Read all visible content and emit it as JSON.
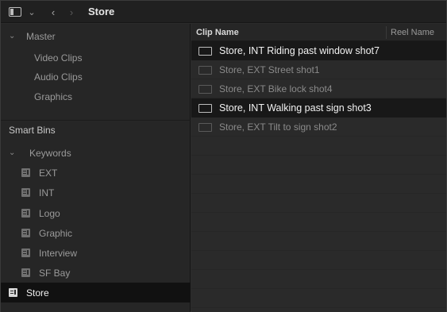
{
  "topbar": {
    "bin_title": "Store",
    "icons": [
      "panel-toggle-icon",
      "chevron-down-icon",
      "back-arrow-icon",
      "forward-arrow-icon"
    ]
  },
  "sidebar": {
    "master": {
      "label": "Master",
      "items": [
        {
          "label": "Video Clips"
        },
        {
          "label": "Audio Clips"
        },
        {
          "label": "Graphics"
        }
      ]
    },
    "smart_bins": {
      "label": "Smart Bins"
    },
    "keywords": {
      "label": "Keywords",
      "items": [
        {
          "label": "EXT"
        },
        {
          "label": "INT"
        },
        {
          "label": "Logo"
        },
        {
          "label": "Graphic"
        },
        {
          "label": "Interview"
        },
        {
          "label": "SF Bay"
        },
        {
          "label": "Store"
        }
      ],
      "active_index": 6
    }
  },
  "main": {
    "columns": {
      "clip_name": "Clip Name",
      "reel_name": "Reel Name"
    },
    "clips": [
      {
        "name": "Store, INT Riding past window shot7",
        "highlighted": true
      },
      {
        "name": "Store, EXT Street shot1",
        "highlighted": false
      },
      {
        "name": "Store, EXT Bike lock shot4",
        "highlighted": false
      },
      {
        "name": "Store, INT Walking past sign shot3",
        "highlighted": true
      },
      {
        "name": "Store, EXT Tilt to sign shot2",
        "highlighted": false
      }
    ]
  },
  "colors": {
    "background": "#2a2a2a",
    "highlight_row": "#181818",
    "active_bin": "#111111",
    "text_bright": "#f2f2f2",
    "text_dim": "#9a9a9a"
  }
}
